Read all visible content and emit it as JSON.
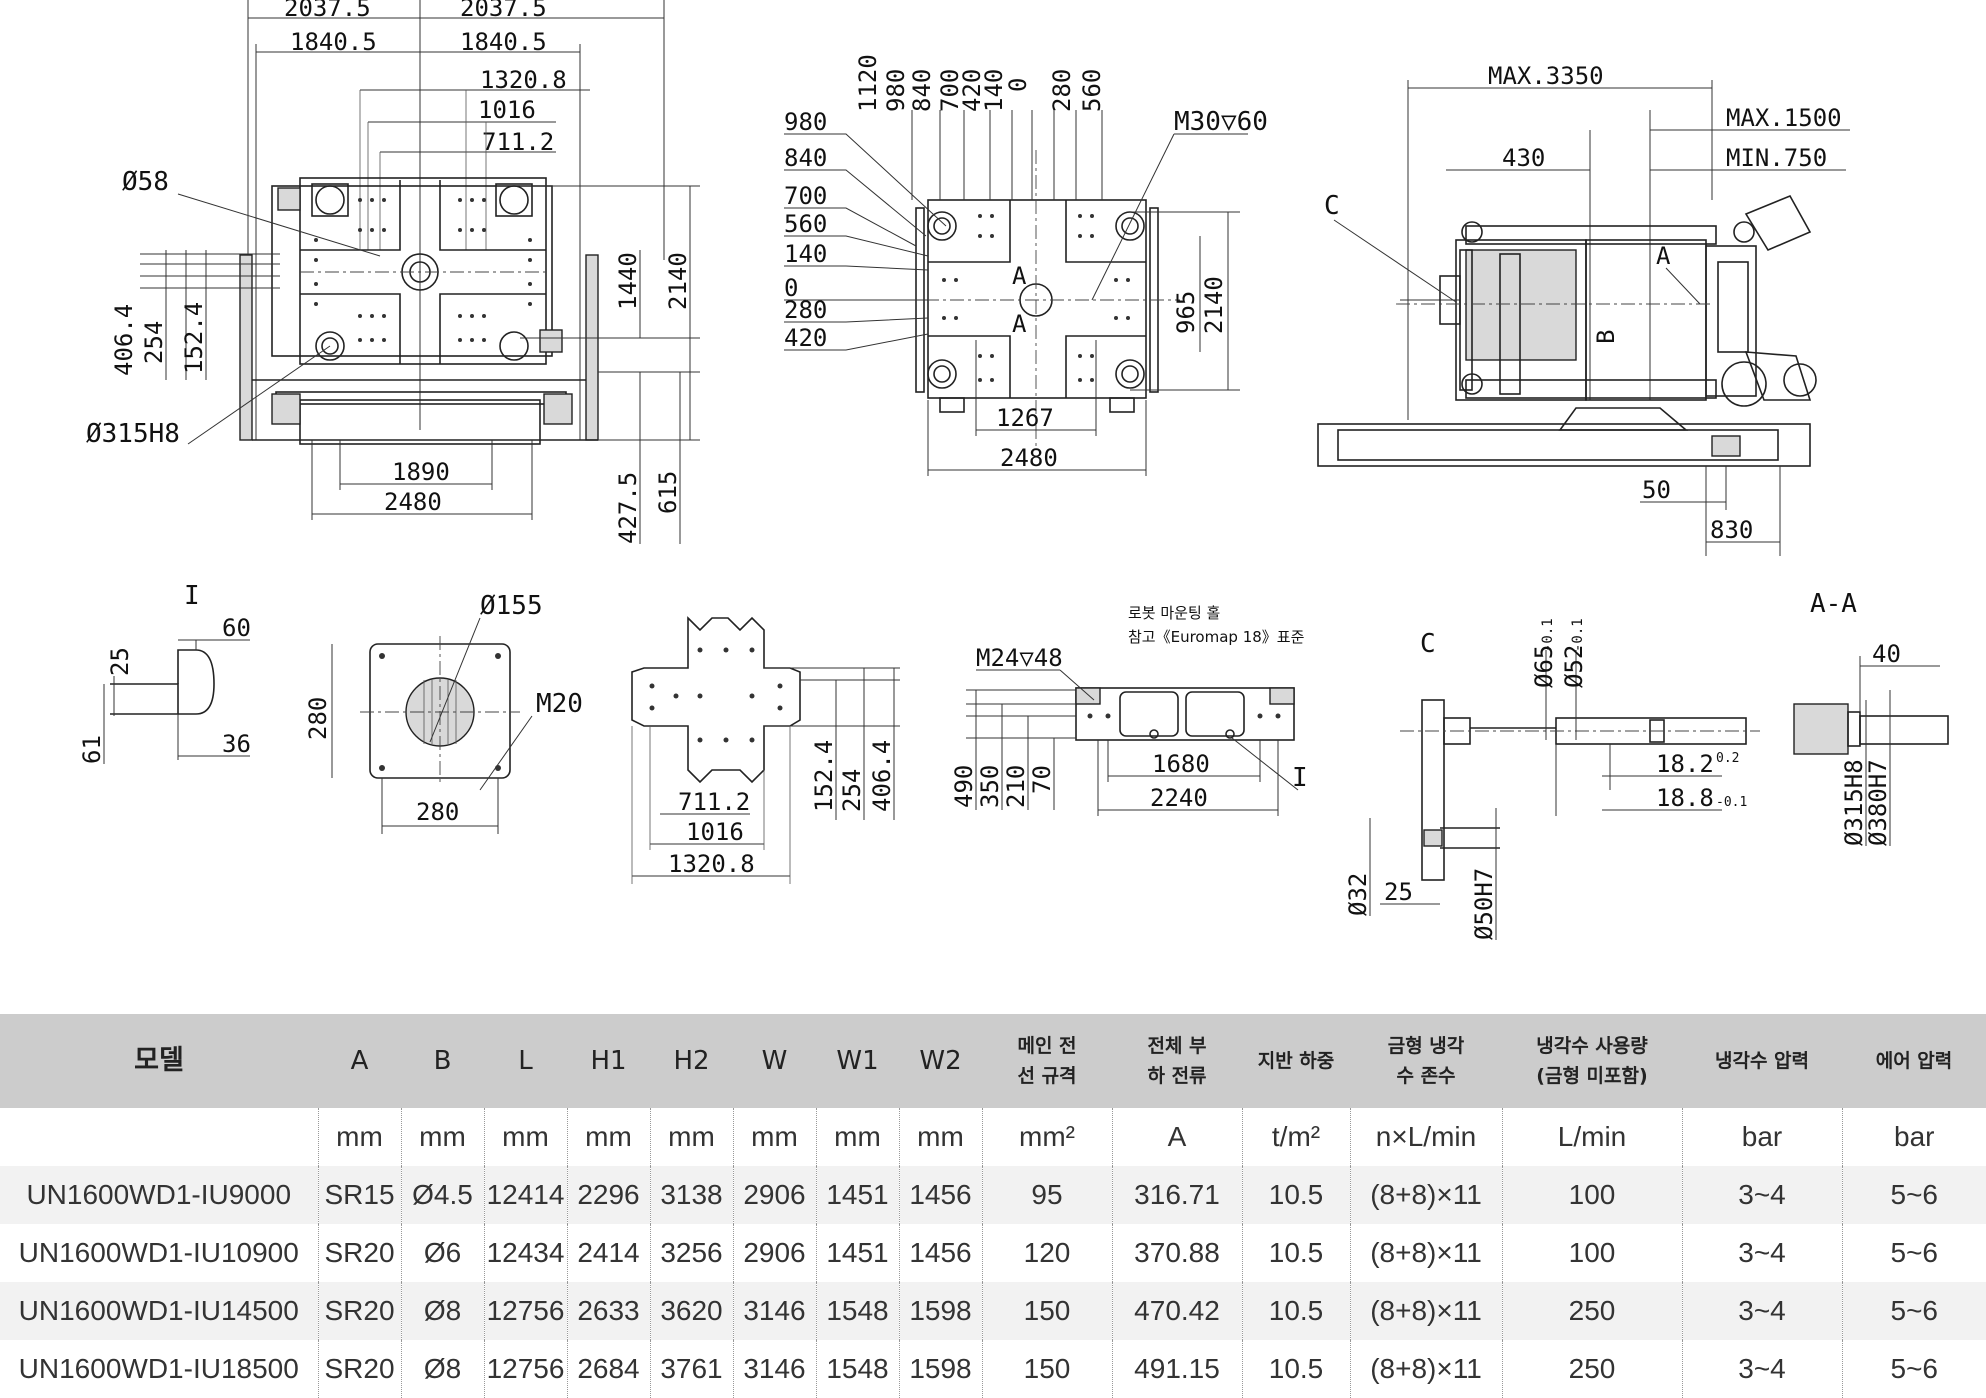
{
  "drawing": {
    "front_view": {
      "dims": [
        "2037.5",
        "2037.5",
        "1840.5",
        "1840.5",
        "1320.8",
        "1016",
        "711.2",
        "1440",
        "2140",
        "406.4",
        "254",
        "152.4",
        "1890",
        "2480",
        "427.5",
        "615"
      ],
      "callouts": [
        "Ø58",
        "Ø315H8"
      ]
    },
    "platen_view": {
      "top_dims": [
        "1120",
        "980",
        "840",
        "700",
        "420",
        "140",
        "0",
        "280",
        "560"
      ],
      "left_dims": [
        "980",
        "840",
        "700",
        "560",
        "140",
        "0",
        "280",
        "420"
      ],
      "thread": "M30▽60",
      "section": "A",
      "right_dims": [
        "965",
        "2140"
      ],
      "bottom_dims": [
        "1267",
        "2480"
      ]
    },
    "side_view": {
      "dims": [
        "MAX.3350",
        "MAX.1500",
        "430",
        "MIN.750",
        "50",
        "830"
      ],
      "markers": [
        "C",
        "A",
        "B"
      ]
    },
    "detail_i": {
      "title": "I",
      "dims": [
        "25",
        "60",
        "61",
        "36"
      ]
    },
    "plate_detail": {
      "dims": [
        "Ø155",
        "M20",
        "280",
        "280"
      ]
    },
    "cross_plate": {
      "dims": [
        "152.4",
        "254",
        "406.4",
        "711.2",
        "1016",
        "1320.8"
      ]
    },
    "robot_mount": {
      "note_line1": "로봇 마운팅 홀",
      "note_line2": "참고《Euromap 18》표준",
      "thread": "M24▽48",
      "left_dims": [
        "490",
        "350",
        "210",
        "70"
      ],
      "bottom_dims": [
        "1680",
        "2240"
      ],
      "marker": "I"
    },
    "detail_c": {
      "title": "C",
      "top_dims": [
        "Ø65",
        "-0.1",
        "Ø52",
        "-0.1"
      ],
      "right_dims": [
        "18.2",
        "0.2",
        "18.8",
        "-0.1"
      ],
      "bottom_dims": [
        "Ø32",
        "25",
        "Ø50H7"
      ]
    },
    "section_aa": {
      "title": "A-A",
      "dims": [
        "40",
        "Ø315H8",
        "Ø380H7"
      ]
    }
  },
  "table": {
    "headers": [
      {
        "line1": "모델",
        "line2": ""
      },
      {
        "line1": "A",
        "line2": ""
      },
      {
        "line1": "B",
        "line2": ""
      },
      {
        "line1": "L",
        "line2": ""
      },
      {
        "line1": "H1",
        "line2": ""
      },
      {
        "line1": "H2",
        "line2": ""
      },
      {
        "line1": "W",
        "line2": ""
      },
      {
        "line1": "W1",
        "line2": ""
      },
      {
        "line1": "W2",
        "line2": ""
      },
      {
        "line1": "메인 전",
        "line2": "선 규격"
      },
      {
        "line1": "전체 부",
        "line2": "하 전류"
      },
      {
        "line1": "지반 하중",
        "line2": ""
      },
      {
        "line1": "금형 냉각",
        "line2": "수 존수"
      },
      {
        "line1": "냉각수 사용량",
        "line2": "(금형 미포함)"
      },
      {
        "line1": "냉각수 압력",
        "line2": ""
      },
      {
        "line1": "에어 압력",
        "line2": ""
      }
    ],
    "units": [
      "",
      "mm",
      "mm",
      "mm",
      "mm",
      "mm",
      "mm",
      "mm",
      "mm",
      "mm²",
      "A",
      "t/m²",
      "n×L/min",
      "L/min",
      "bar",
      "bar"
    ],
    "rows": [
      [
        "UN1600WD1-IU9000",
        "SR15",
        "Ø4.5",
        "12414",
        "2296",
        "3138",
        "2906",
        "1451",
        "1456",
        "95",
        "316.71",
        "10.5",
        "(8+8)×11",
        "100",
        "3~4",
        "5~6"
      ],
      [
        "UN1600WD1-IU10900",
        "SR20",
        "Ø6",
        "12434",
        "2414",
        "3256",
        "2906",
        "1451",
        "1456",
        "120",
        "370.88",
        "10.5",
        "(8+8)×11",
        "100",
        "3~4",
        "5~6"
      ],
      [
        "UN1600WD1-IU14500",
        "SR20",
        "Ø8",
        "12756",
        "2633",
        "3620",
        "3146",
        "1548",
        "1598",
        "150",
        "470.42",
        "10.5",
        "(8+8)×11",
        "250",
        "3~4",
        "5~6"
      ],
      [
        "UN1600WD1-IU18500",
        "SR20",
        "Ø8",
        "12756",
        "2684",
        "3761",
        "3146",
        "1548",
        "1598",
        "150",
        "491.15",
        "10.5",
        "(8+8)×11",
        "250",
        "3~4",
        "5~6"
      ]
    ]
  }
}
